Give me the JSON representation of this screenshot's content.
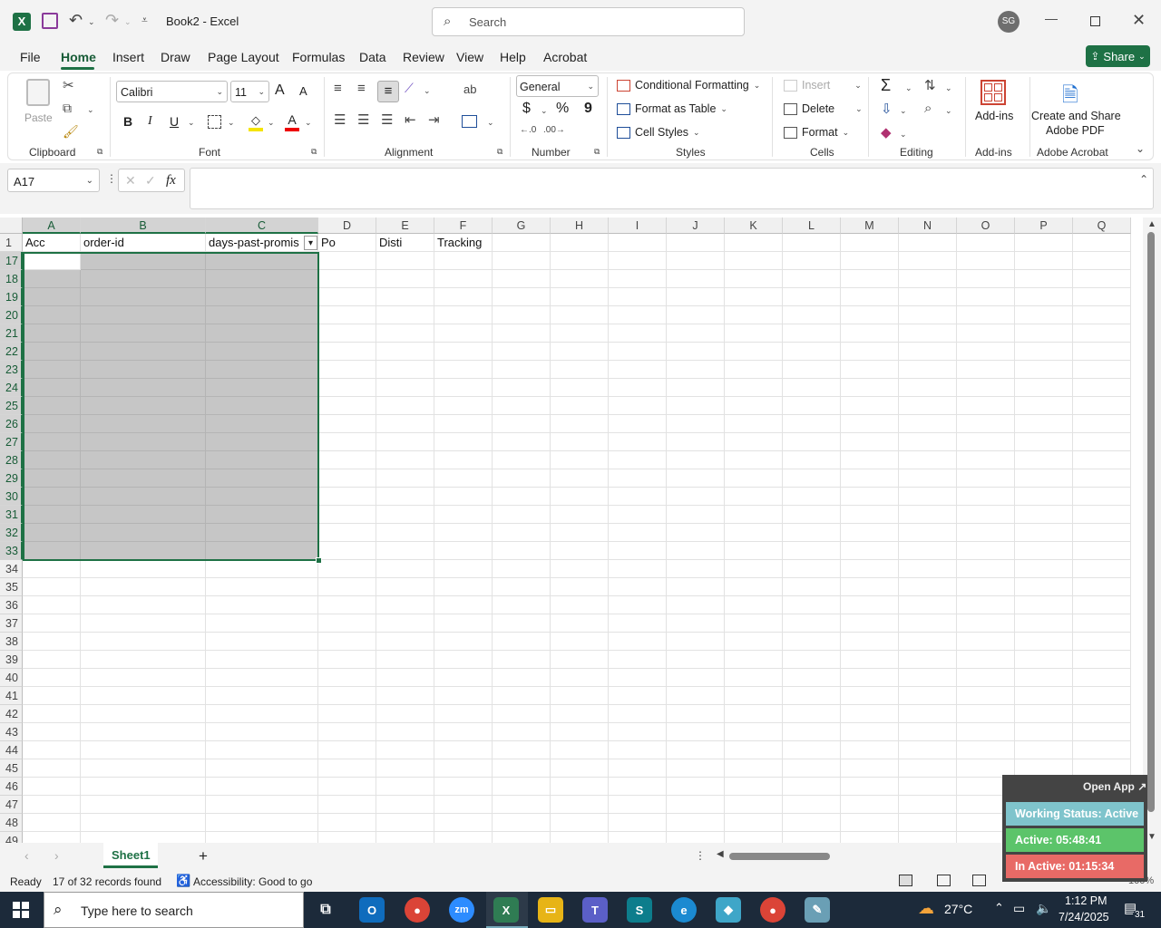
{
  "app": {
    "title": "Book2 - Excel",
    "search_placeholder": "Search",
    "user_initials": "SG",
    "share_label": "Share"
  },
  "menu": [
    "File",
    "Home",
    "Insert",
    "Draw",
    "Page Layout",
    "Formulas",
    "Data",
    "Review",
    "View",
    "Help",
    "Acrobat"
  ],
  "ribbon": {
    "clipboard": {
      "paste": "Paste",
      "label": "Clipboard"
    },
    "font": {
      "name": "Calibri",
      "size": "11",
      "bold": "B",
      "italic": "I",
      "underline": "U",
      "grow": "A",
      "shrink": "A",
      "label": "Font"
    },
    "alignment": {
      "label": "Alignment"
    },
    "number": {
      "format": "General",
      "currency": "$",
      "percent": "%",
      "comma": "9",
      "label": "Number"
    },
    "styles": {
      "conditional": "Conditional Formatting",
      "format_table": "Format as Table",
      "cell_styles": "Cell Styles",
      "label": "Styles"
    },
    "cells": {
      "insert": "Insert",
      "delete": "Delete",
      "format": "Format",
      "label": "Cells"
    },
    "editing": {
      "sum": "Σ",
      "label": "Editing"
    },
    "addins": {
      "btn": "Add-ins",
      "label": "Add-ins"
    },
    "acrobat": {
      "line1": "Create and Share",
      "line2": "Adobe PDF",
      "label": "Adobe Acrobat"
    }
  },
  "formula_bar": {
    "name_box": "A17",
    "fx": "fx",
    "value": ""
  },
  "columns": [
    "A",
    "B",
    "C",
    "D",
    "E",
    "F",
    "G",
    "H",
    "I",
    "J",
    "K",
    "L",
    "M",
    "N",
    "O",
    "P",
    "Q"
  ],
  "header_row": {
    "row": "1",
    "cells": [
      "Acc",
      "order-id",
      "days-past-promis",
      "Po",
      "Disti",
      "Tracking",
      "",
      "",
      "",
      "",
      "",
      "",
      "",
      "",
      "",
      "",
      ""
    ]
  },
  "rows": [
    "17",
    "18",
    "19",
    "20",
    "21",
    "22",
    "23",
    "24",
    "25",
    "26",
    "27",
    "28",
    "29",
    "30",
    "31",
    "32",
    "33",
    "34",
    "35",
    "36",
    "37",
    "38",
    "39",
    "40",
    "41",
    "42",
    "43",
    "44",
    "45",
    "46",
    "47",
    "48",
    "49"
  ],
  "sheets": {
    "active": "Sheet1",
    "add": "+"
  },
  "status": {
    "ready": "Ready",
    "records": "17 of 32 records found",
    "accessibility": "Accessibility: Good to go",
    "zoom": "100%"
  },
  "widget": {
    "open_app": "Open App ↗",
    "working": "Working Status: Active",
    "active": "Active: 05:48:41",
    "inactive": "In Active: 01:15:34",
    "colors": {
      "working": "#7fc4cc",
      "active": "#5cc46a",
      "inactive": "#e86a66"
    }
  },
  "taskbar": {
    "search": "Type here to search",
    "temp": "27°C",
    "time": "1:12 PM",
    "date": "7/24/2025",
    "notif": "31"
  }
}
